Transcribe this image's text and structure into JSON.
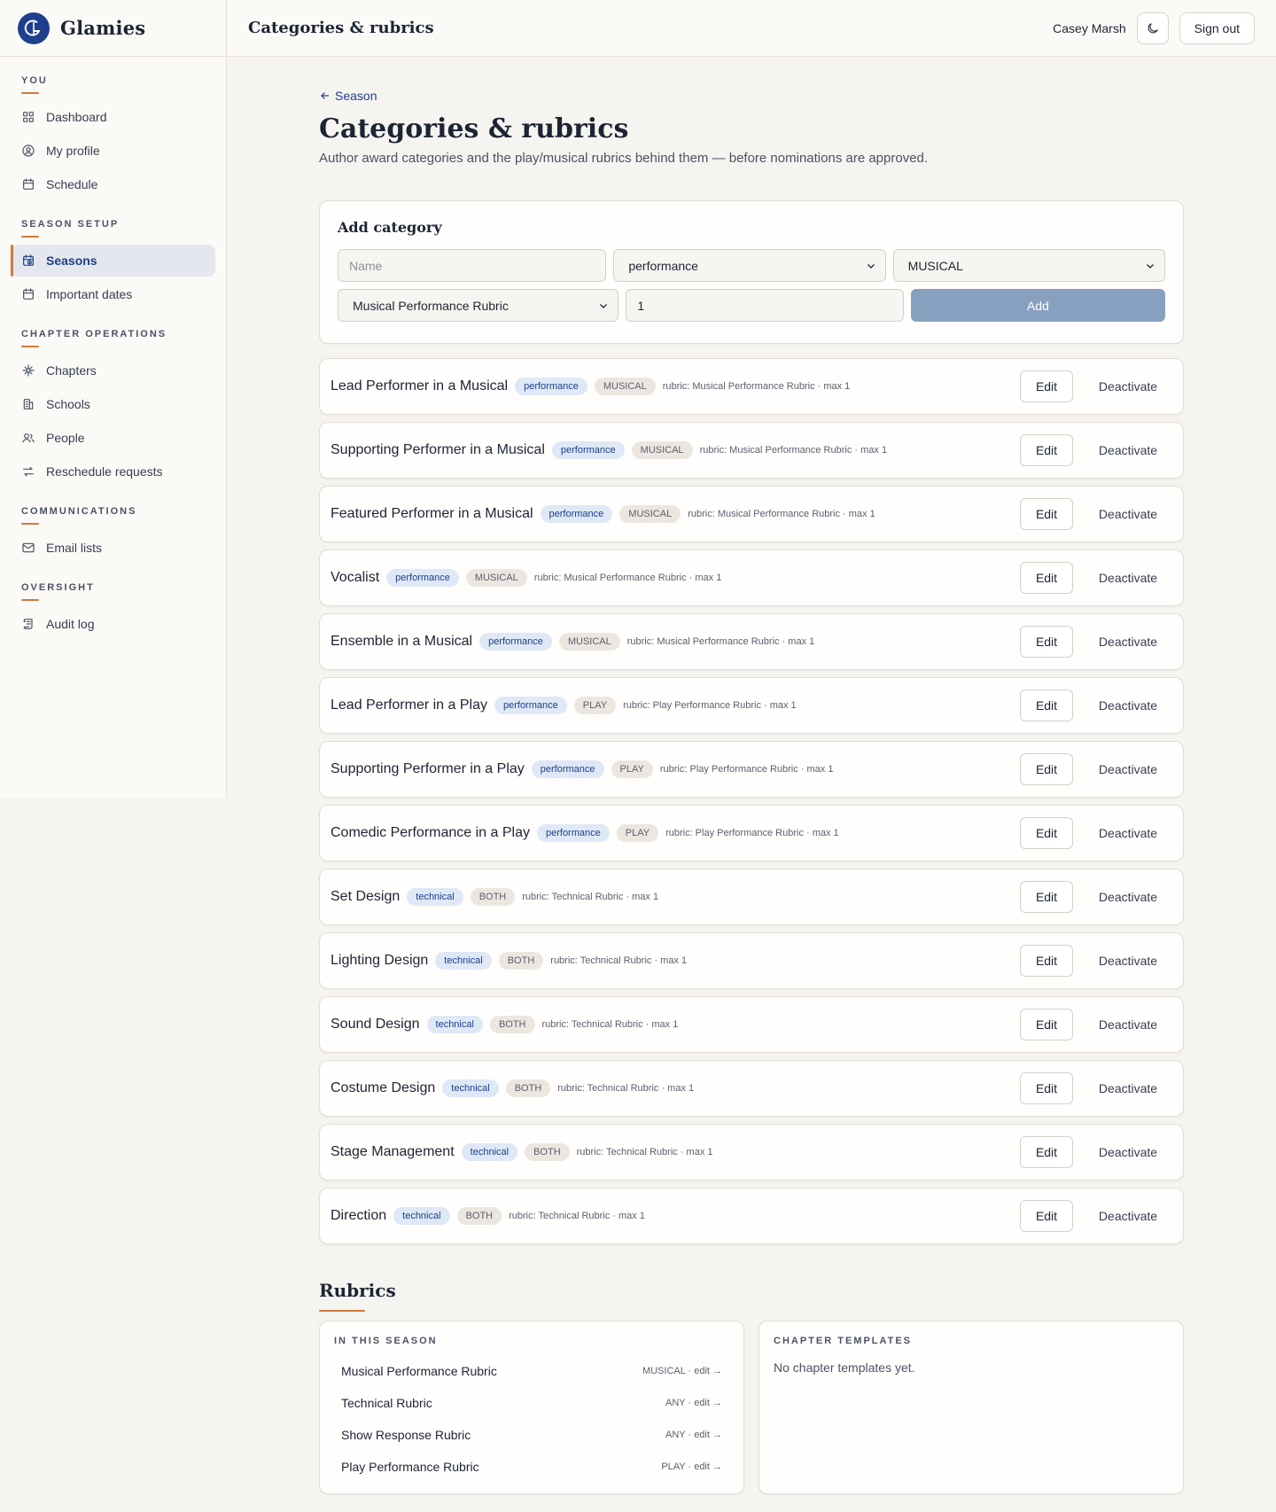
{
  "brand": {
    "name": "Glamies"
  },
  "topbar": {
    "title": "Categories & rubrics",
    "user": "Casey Marsh",
    "sign_out": "Sign out"
  },
  "sidebar": {
    "sections": [
      {
        "heading": "YOU",
        "items": [
          {
            "label": "Dashboard",
            "icon": "grid-icon",
            "active": false
          },
          {
            "label": "My profile",
            "icon": "user-circle-icon",
            "active": false
          },
          {
            "label": "Schedule",
            "icon": "calendar-icon",
            "active": false
          }
        ]
      },
      {
        "heading": "SEASON SETUP",
        "items": [
          {
            "label": "Seasons",
            "icon": "calendar-clock-icon",
            "active": true
          },
          {
            "label": "Important dates",
            "icon": "calendar-icon",
            "active": false
          }
        ]
      },
      {
        "heading": "CHAPTER OPERATIONS",
        "items": [
          {
            "label": "Chapters",
            "icon": "network-icon",
            "active": false
          },
          {
            "label": "Schools",
            "icon": "building-icon",
            "active": false
          },
          {
            "label": "People",
            "icon": "users-icon",
            "active": false
          },
          {
            "label": "Reschedule requests",
            "icon": "swap-icon",
            "active": false
          }
        ]
      },
      {
        "heading": "COMMUNICATIONS",
        "items": [
          {
            "label": "Email lists",
            "icon": "mail-icon",
            "active": false
          }
        ]
      },
      {
        "heading": "OVERSIGHT",
        "items": [
          {
            "label": "Audit log",
            "icon": "scroll-icon",
            "active": false
          }
        ]
      }
    ]
  },
  "main": {
    "back_label": "Season",
    "title": "Categories & rubrics",
    "subtitle": "Author award categories and the play/musical rubrics behind them — before nominations are approved.",
    "add_form": {
      "title": "Add category",
      "name_placeholder": "Name",
      "type_value": "performance",
      "kind_value": "MUSICAL",
      "rubric_value": "Musical Performance Rubric",
      "max_value": "1",
      "add_label": "Add"
    },
    "edit_label": "Edit",
    "deactivate_label": "Deactivate",
    "categories": [
      {
        "name": "Lead Performer in a Musical",
        "type": "performance",
        "kind": "MUSICAL",
        "meta": "rubric: Musical Performance Rubric · max 1"
      },
      {
        "name": "Supporting Performer in a Musical",
        "type": "performance",
        "kind": "MUSICAL",
        "meta": "rubric: Musical Performance Rubric · max 1"
      },
      {
        "name": "Featured Performer in a Musical",
        "type": "performance",
        "kind": "MUSICAL",
        "meta": "rubric: Musical Performance Rubric · max 1"
      },
      {
        "name": "Vocalist",
        "type": "performance",
        "kind": "MUSICAL",
        "meta": "rubric: Musical Performance Rubric · max 1"
      },
      {
        "name": "Ensemble in a Musical",
        "type": "performance",
        "kind": "MUSICAL",
        "meta": "rubric: Musical Performance Rubric · max 1"
      },
      {
        "name": "Lead Performer in a Play",
        "type": "performance",
        "kind": "PLAY",
        "meta": "rubric: Play Performance Rubric · max 1"
      },
      {
        "name": "Supporting Performer in a Play",
        "type": "performance",
        "kind": "PLAY",
        "meta": "rubric: Play Performance Rubric · max 1"
      },
      {
        "name": "Comedic Performance in a Play",
        "type": "performance",
        "kind": "PLAY",
        "meta": "rubric: Play Performance Rubric · max 1"
      },
      {
        "name": "Set Design",
        "type": "technical",
        "kind": "BOTH",
        "meta": "rubric: Technical Rubric · max 1"
      },
      {
        "name": "Lighting Design",
        "type": "technical",
        "kind": "BOTH",
        "meta": "rubric: Technical Rubric · max 1"
      },
      {
        "name": "Sound Design",
        "type": "technical",
        "kind": "BOTH",
        "meta": "rubric: Technical Rubric · max 1"
      },
      {
        "name": "Costume Design",
        "type": "technical",
        "kind": "BOTH",
        "meta": "rubric: Technical Rubric · max 1"
      },
      {
        "name": "Stage Management",
        "type": "technical",
        "kind": "BOTH",
        "meta": "rubric: Technical Rubric · max 1"
      },
      {
        "name": "Direction",
        "type": "technical",
        "kind": "BOTH",
        "meta": "rubric: Technical Rubric · max 1"
      }
    ],
    "rubrics": {
      "title": "Rubrics",
      "season_heading": "IN THIS SEASON",
      "season_items": [
        {
          "name": "Musical Performance Rubric",
          "meta": "MUSICAL · edit →"
        },
        {
          "name": "Technical Rubric",
          "meta": "ANY · edit →"
        },
        {
          "name": "Show Response Rubric",
          "meta": "ANY · edit →"
        },
        {
          "name": "Play Performance Rubric",
          "meta": "PLAY · edit →"
        }
      ],
      "templates_heading": "CHAPTER TEMPLATES",
      "templates_empty": "No chapter templates yet."
    }
  },
  "colors": {
    "accent": "#d07a3c",
    "brand": "#1d3f8c",
    "add_button": "#87a0bf"
  }
}
